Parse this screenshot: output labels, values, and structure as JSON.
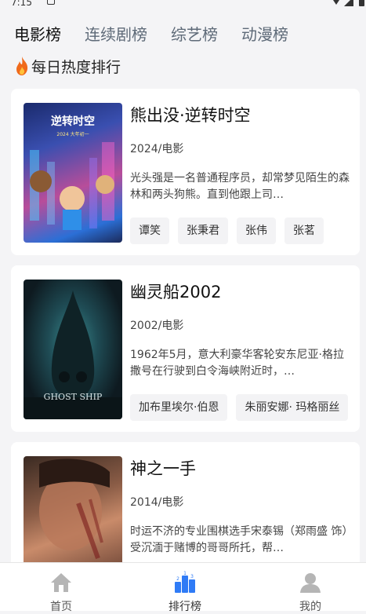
{
  "status_bar": {
    "time": "7:15"
  },
  "tabs": [
    {
      "label": "电影榜",
      "active": true
    },
    {
      "label": "连续剧榜",
      "active": false
    },
    {
      "label": "综艺榜",
      "active": false
    },
    {
      "label": "动漫榜",
      "active": false
    }
  ],
  "section": {
    "title": "每日热度排行",
    "icon": "fire-icon"
  },
  "items": [
    {
      "title": "熊出没·逆转时空",
      "meta": "2024/电影",
      "desc": "光头强是一名普通程序员，却常梦见陌生的森林和两头狗熊。直到他跟上司…",
      "tags": [
        "谭笑",
        "张秉君",
        "张伟",
        "张茗"
      ],
      "poster_text": [
        "逆转时空",
        "2024 大年初一"
      ]
    },
    {
      "title": "幽灵船2002",
      "meta": "2002/电影",
      "desc": "1962年5月，意大利豪华客轮安东尼亚·格拉撒号在行驶到白令海峡附近时，…",
      "tags": [
        "加布里埃尔·伯恩",
        "朱丽安娜· 玛格丽丝"
      ],
      "poster_text": [
        "GHOST SHIP"
      ]
    },
    {
      "title": "神之一手",
      "meta": "2014/电影",
      "desc": "时运不济的专业围棋选手宋泰锡（郑雨盛 饰）受沉湎于赌博的哥哥所托，帮…",
      "tags": [],
      "poster_text": []
    }
  ],
  "bottom_nav": [
    {
      "label": "首页",
      "icon": "home-icon",
      "active": false
    },
    {
      "label": "排行榜",
      "icon": "ranking-icon",
      "active": true
    },
    {
      "label": "我的",
      "icon": "user-icon",
      "active": false
    }
  ],
  "colors": {
    "background": "#f4f4f6",
    "card": "#ffffff",
    "tag_bg": "#f3f3f5",
    "active_icon": "#2f7bf6",
    "inactive_icon": "#b5b5b5"
  }
}
